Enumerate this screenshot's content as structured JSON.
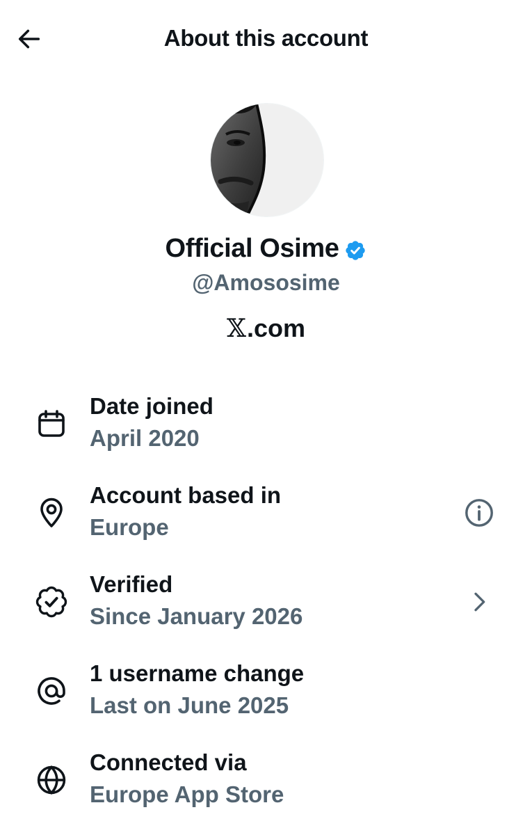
{
  "header": {
    "title": "About this account",
    "back_icon": "arrow-left-icon"
  },
  "profile": {
    "display_name": "Official Osime",
    "handle": "@Amososime",
    "verified_badge_icon": "verified-badge-icon",
    "badge_color": "#1d9bf0",
    "site_logo": "𝕏",
    "site_suffix": ".com"
  },
  "details": [
    {
      "icon": "calendar-icon",
      "label": "Date joined",
      "value": "April 2020"
    },
    {
      "icon": "location-pin-icon",
      "label": "Account based in",
      "value": "Europe",
      "trailing_icon": "info-icon"
    },
    {
      "icon": "verified-outline-icon",
      "label": "Verified",
      "value": "Since January 2026",
      "trailing_icon": "chevron-right-icon"
    },
    {
      "icon": "at-sign-icon",
      "label": "1 username change",
      "value": "Last on June 2025"
    },
    {
      "icon": "globe-icon",
      "label": "Connected via",
      "value": "Europe App Store"
    }
  ],
  "colors": {
    "primary_text": "#0f1419",
    "secondary_text": "#536471",
    "background": "#ffffff"
  }
}
